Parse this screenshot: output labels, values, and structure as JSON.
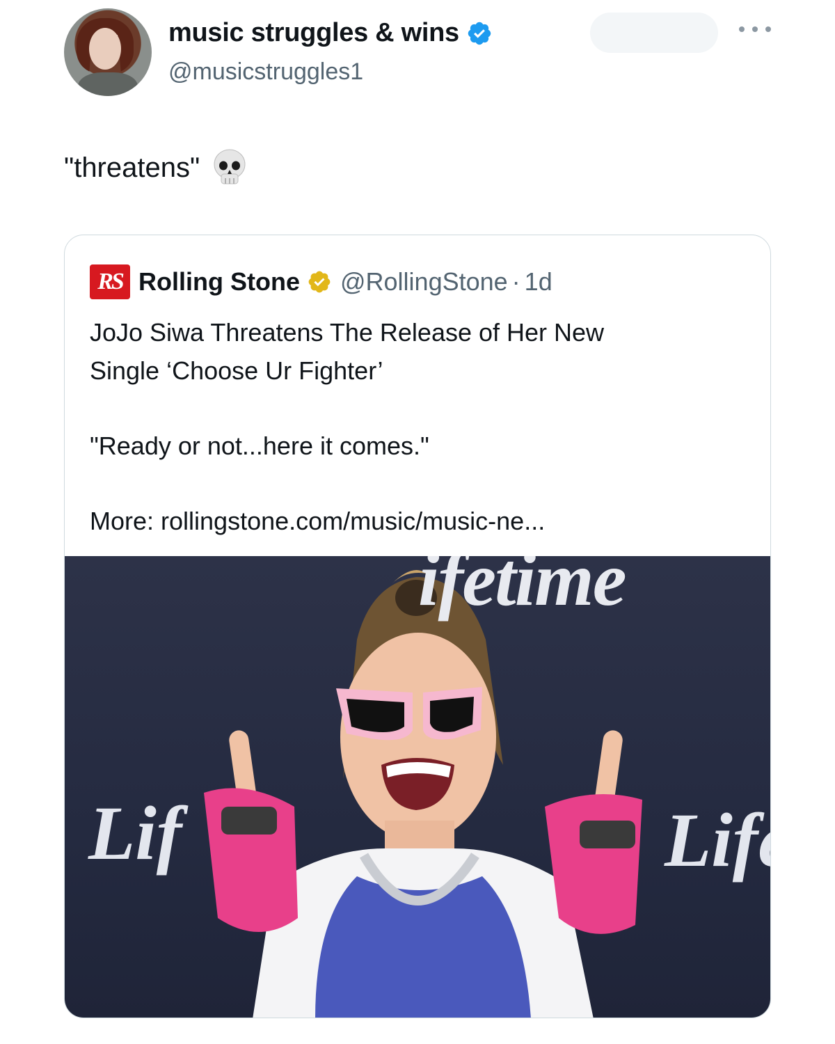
{
  "author": {
    "display_name": "music struggles & wins",
    "handle": "@musicstruggles1",
    "verified": "blue-check-icon"
  },
  "tweet": {
    "text": "\"threatens\"",
    "emoji": "skull-icon"
  },
  "quote": {
    "logo_text": "RS",
    "name": "Rolling Stone",
    "verified": "gold-check-icon",
    "handle": "@RollingStone",
    "separator": "·",
    "time": "1d",
    "headline_line1": "JoJo Siwa Threatens The Release of Her  New",
    "headline_line2": "Single ‘Choose Ur Fighter’",
    "quote_line": "\"Ready or not...here it comes.\"",
    "more_link": "More: rollingstone.com/music/music-ne..."
  },
  "photo": {
    "watermark_top": "ifetime",
    "watermark_left": "Lif",
    "watermark_right": "Life"
  },
  "colors": {
    "verified_blue": "#1d9bf0",
    "verified_gold": "#e2b719",
    "rs_red": "#d71920",
    "secondary_text": "#536471"
  }
}
